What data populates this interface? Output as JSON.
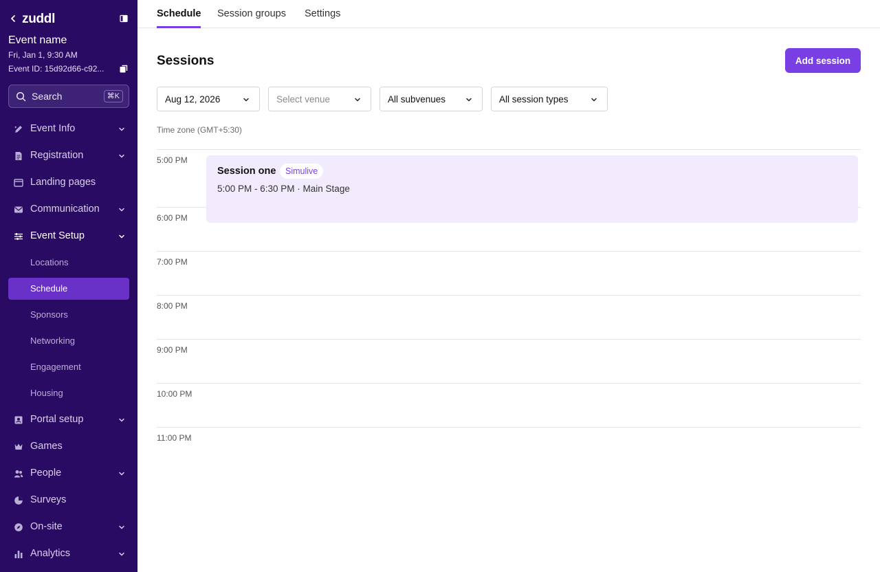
{
  "sidebar": {
    "brand": "zuddl",
    "event_name": "Event name",
    "event_date": "Fri, Jan 1, 9:30 AM",
    "event_id": "Event ID: 15d92d66-c92...",
    "search": {
      "label": "Search",
      "shortcut": "⌘K"
    },
    "nav": [
      {
        "label": "Event Info",
        "icon": "pencil-icon",
        "expandable": true
      },
      {
        "label": "Registration",
        "icon": "document-icon",
        "expandable": true
      },
      {
        "label": "Landing pages",
        "icon": "browser-icon",
        "expandable": false
      },
      {
        "label": "Communication",
        "icon": "mail-icon",
        "expandable": true
      },
      {
        "label": "Event Setup",
        "icon": "sliders-icon",
        "expandable": true,
        "open": true
      },
      {
        "label": "Portal setup",
        "icon": "portal-icon",
        "expandable": true
      },
      {
        "label": "Games",
        "icon": "crown-icon",
        "expandable": false
      },
      {
        "label": "People",
        "icon": "people-icon",
        "expandable": true
      },
      {
        "label": "Surveys",
        "icon": "pie-icon",
        "expandable": false
      },
      {
        "label": "On-site",
        "icon": "compass-icon",
        "expandable": true
      },
      {
        "label": "Analytics",
        "icon": "bar-chart-icon",
        "expandable": true
      }
    ],
    "event_setup_children": [
      {
        "label": "Locations",
        "selected": false
      },
      {
        "label": "Schedule",
        "selected": true
      },
      {
        "label": "Sponsors",
        "selected": false
      },
      {
        "label": "Networking",
        "selected": false
      },
      {
        "label": "Engagement",
        "selected": false
      },
      {
        "label": "Housing",
        "selected": false
      }
    ]
  },
  "tabs": [
    {
      "label": "Schedule",
      "active": true
    },
    {
      "label": "Session groups",
      "active": false
    },
    {
      "label": "Settings",
      "active": false
    }
  ],
  "main": {
    "title": "Sessions",
    "add_button": "Add session",
    "filters": {
      "date": "Aug 12, 2026",
      "venue_placeholder": "Select venue",
      "subvenues": "All subvenues",
      "session_types": "All session types"
    },
    "timezone": "Time zone (GMT+5:30)",
    "hours": [
      "5:00 PM",
      "6:00 PM",
      "7:00 PM",
      "8:00 PM",
      "9:00 PM",
      "10:00 PM",
      "11:00 PM"
    ],
    "session": {
      "title": "Session one",
      "badge": "Simulive",
      "meta": "5:00 PM - 6:30 PM · Main Stage"
    }
  },
  "colors": {
    "sidebar_bg": "#2a0b63",
    "accent": "#7a3fe4",
    "selected_item": "#6a31c9",
    "session_bg": "#f1ebfd"
  }
}
